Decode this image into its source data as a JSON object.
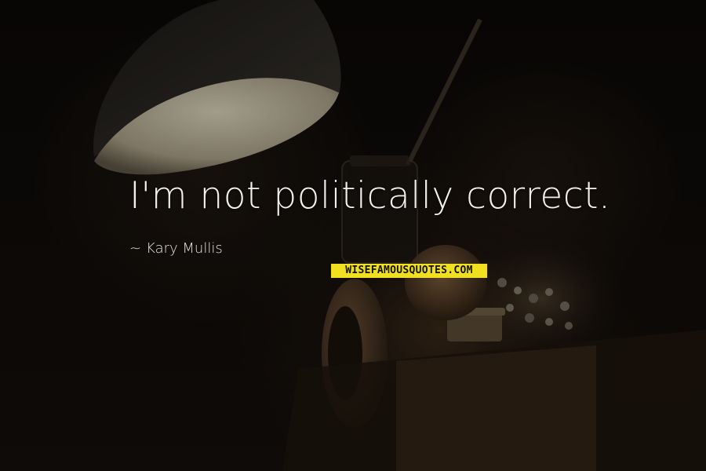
{
  "quote": {
    "text": "I'm not politically correct.",
    "author_prefix": "~",
    "author": "Kary Mullis"
  },
  "watermark": {
    "label": "WISEFAMOUSQUOTES.COM"
  },
  "colors": {
    "quote_text": "#f2f0ec",
    "author_text": "#e6e3de",
    "watermark_bg": "#f0e020",
    "background": "#0d0a08"
  }
}
